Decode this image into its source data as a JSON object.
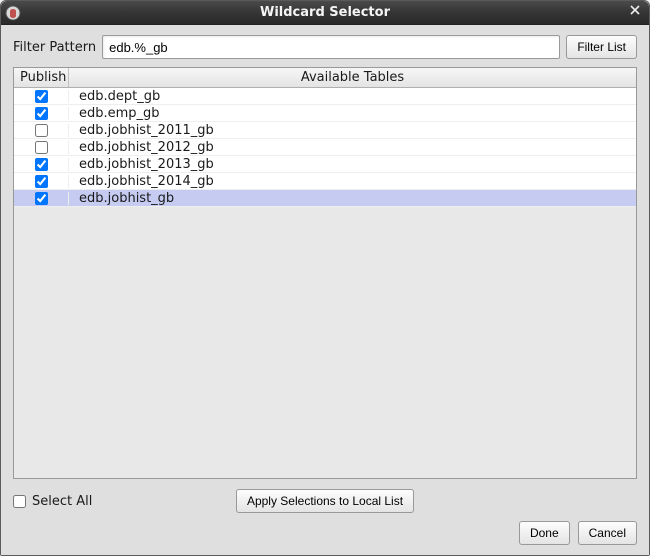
{
  "titlebar": {
    "title": "Wildcard Selector"
  },
  "filter": {
    "label": "Filter Pattern",
    "value": "edb.%_gb",
    "button": "Filter List"
  },
  "table": {
    "headers": {
      "publish": "Publish",
      "available": "Available Tables"
    },
    "rows": [
      {
        "checked": true,
        "selected": false,
        "name": "edb.dept_gb"
      },
      {
        "checked": true,
        "selected": false,
        "name": "edb.emp_gb"
      },
      {
        "checked": false,
        "selected": false,
        "name": "edb.jobhist_2011_gb"
      },
      {
        "checked": false,
        "selected": false,
        "name": "edb.jobhist_2012_gb"
      },
      {
        "checked": true,
        "selected": false,
        "name": "edb.jobhist_2013_gb"
      },
      {
        "checked": true,
        "selected": false,
        "name": "edb.jobhist_2014_gb"
      },
      {
        "checked": true,
        "selected": true,
        "name": "edb.jobhist_gb"
      }
    ]
  },
  "footer": {
    "select_all": "Select All",
    "select_all_checked": false,
    "apply": "Apply Selections to Local List",
    "done": "Done",
    "cancel": "Cancel"
  }
}
